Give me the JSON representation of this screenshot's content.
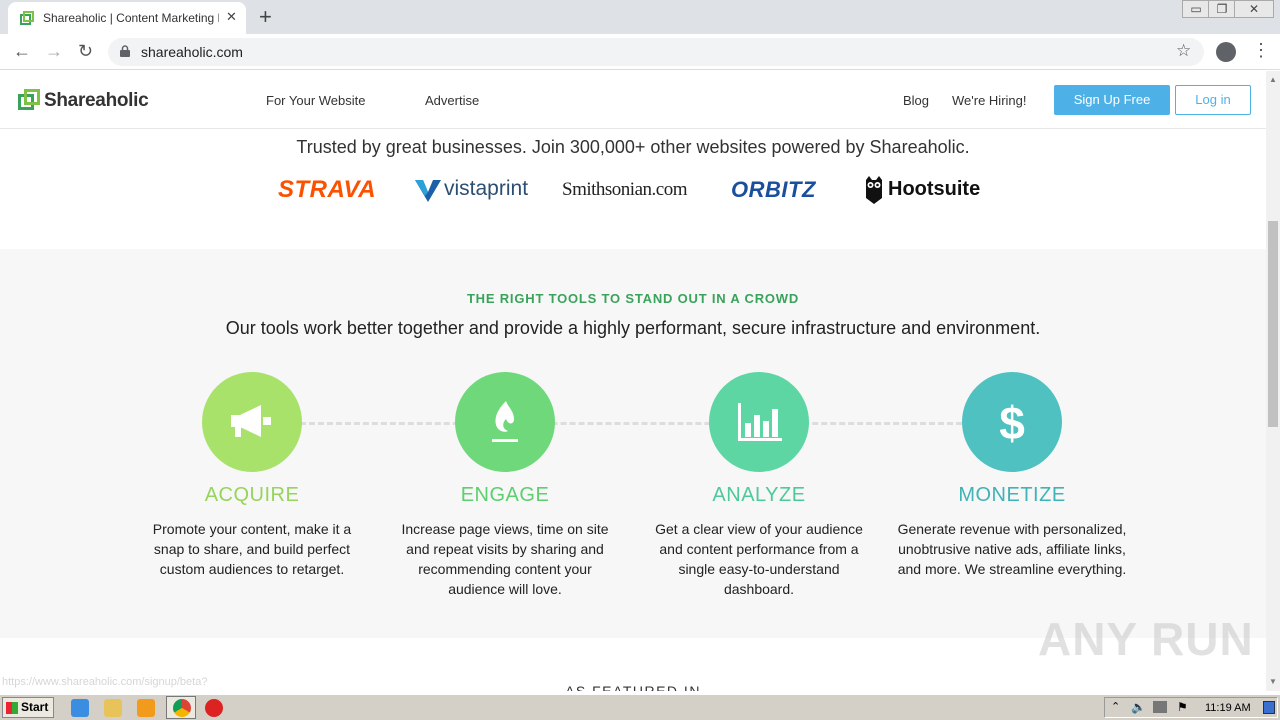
{
  "browser": {
    "tab_title": "Shareaholic | Content Marketing Plat",
    "tab_close": "✕",
    "new_tab": "+",
    "url": "shareaholic.com",
    "window_controls": [
      "▭",
      "❐",
      "✕"
    ]
  },
  "site": {
    "logo_text": "Shareaholic",
    "nav": {
      "for_your_website": "For Your Website",
      "advertise": "Advertise",
      "blog": "Blog",
      "hiring": "We're Hiring!",
      "signup": "Sign Up Free",
      "login": "Log in"
    },
    "trusted_text": "Trusted by great businesses. Join 300,000+ other websites powered by Shareaholic.",
    "brands": {
      "strava": "STRAVA",
      "vistaprint": "vistaprint",
      "smithsonian": "Smithsonian.com",
      "orbitz": "ORBITZ",
      "hootsuite": "Hootsuite"
    },
    "tools": {
      "kicker": "THE RIGHT TOOLS TO STAND OUT IN A CROWD",
      "subtitle": "Our tools work better together and provide a highly performant, secure infrastructure and environment.",
      "items": [
        {
          "title": "ACQUIRE",
          "desc": "Promote your content, make it a snap to share, and build perfect custom audiences to retarget.",
          "color": "#a8e26a",
          "title_color": "#97d45a",
          "icon": "megaphone-icon"
        },
        {
          "title": "ENGAGE",
          "desc": "Increase page views, time on site and repeat visits by sharing and recommending content your audience will love.",
          "color": "#6fd87a",
          "title_color": "#5ccf6e",
          "icon": "flame-icon"
        },
        {
          "title": "ANALYZE",
          "desc": "Get a clear view of your audience and content performance from a single easy-to-understand dashboard.",
          "color": "#5dd6a4",
          "title_color": "#4ec99a",
          "icon": "bar-chart-icon"
        },
        {
          "title": "MONETIZE",
          "desc": "Generate revenue with personalized, unobtrusive native ads, affiliate links, and more. We streamline everything.",
          "color": "#4fc1c0",
          "title_color": "#3fb3b6",
          "icon": "dollar-icon"
        }
      ]
    },
    "featured_heading": "AS FEATURED IN",
    "status_url": "https://www.shareaholic.com/signup/beta?",
    "watermark": "ANY RUN"
  },
  "taskbar": {
    "start": "Start",
    "clock": "11:19 AM"
  }
}
